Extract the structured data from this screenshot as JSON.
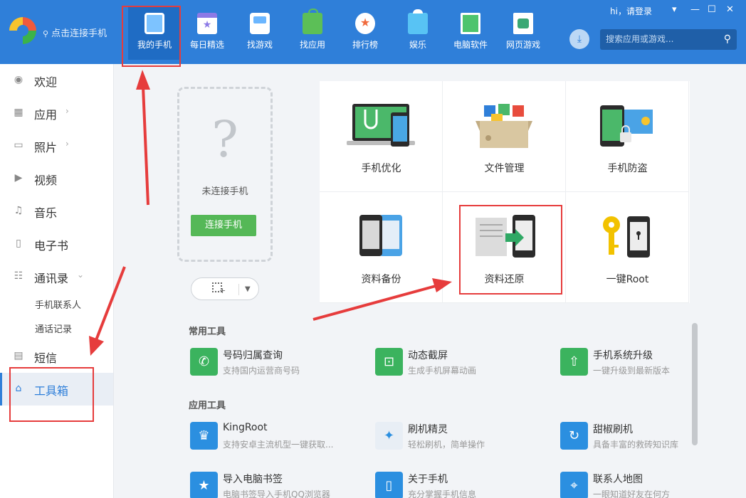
{
  "header": {
    "connect_text": "点击连接手机",
    "login_text": "hi，请登录",
    "search_placeholder": "搜索应用或游戏...",
    "nav": [
      {
        "label": "我的手机",
        "icon": "phone-icon",
        "active": true
      },
      {
        "label": "每日精选",
        "icon": "calendar-star-icon"
      },
      {
        "label": "找游戏",
        "icon": "game-icon"
      },
      {
        "label": "找应用",
        "icon": "app-bag-icon"
      },
      {
        "label": "排行榜",
        "icon": "rank-medal-icon"
      },
      {
        "label": "娱乐",
        "icon": "entertainment-icon"
      },
      {
        "label": "电脑软件",
        "icon": "pc-software-icon"
      },
      {
        "label": "网页游戏",
        "icon": "web-game-icon"
      }
    ]
  },
  "sidebar": {
    "items": [
      {
        "label": "欢迎",
        "icon": "welcome-icon"
      },
      {
        "label": "应用",
        "icon": "apps-grid-icon"
      },
      {
        "label": "照片",
        "icon": "photo-icon"
      },
      {
        "label": "视频",
        "icon": "video-icon"
      },
      {
        "label": "音乐",
        "icon": "music-icon"
      },
      {
        "label": "电子书",
        "icon": "ebook-icon"
      },
      {
        "label": "通讯录",
        "icon": "contacts-icon"
      },
      {
        "label": "短信",
        "icon": "sms-icon"
      },
      {
        "label": "工具箱",
        "icon": "toolbox-icon",
        "active": true
      }
    ],
    "sub_items": [
      "手机联系人",
      "通话记录"
    ]
  },
  "phone_panel": {
    "status": "未连接手机",
    "connect_button": "连接手机"
  },
  "tools": [
    {
      "label": "手机优化"
    },
    {
      "label": "文件管理"
    },
    {
      "label": "手机防盗"
    },
    {
      "label": "资料备份"
    },
    {
      "label": "资料还原"
    },
    {
      "label": "一键Root"
    }
  ],
  "sections": {
    "common_title": "常用工具",
    "app_title": "应用工具"
  },
  "common_tools": [
    {
      "name": "号码归属查询",
      "desc": "支持国内运营商号码",
      "color": "#3bb35e"
    },
    {
      "name": "动态截屏",
      "desc": "生成手机屏幕动画",
      "color": "#3bb35e"
    },
    {
      "name": "手机系统升级",
      "desc": "一键升级到最新版本",
      "color": "#3bb35e"
    }
  ],
  "app_tools": [
    {
      "name": "KingRoot",
      "desc": "支持安卓主流机型一键获取...",
      "color": "#2b8fe0"
    },
    {
      "name": "刷机精灵",
      "desc": "轻松刷机，简单操作",
      "color": "#e8eef5"
    },
    {
      "name": "甜椒刷机",
      "desc": "具备丰富的救砖知识库",
      "color": "#2b8fe0"
    },
    {
      "name": "导入电脑书签",
      "desc": "电脑书签导入手机QQ浏览器",
      "color": "#2b8fe0"
    },
    {
      "name": "关于手机",
      "desc": "充分掌握手机信息",
      "color": "#2b8fe0"
    },
    {
      "name": "联系人地图",
      "desc": "一眼知道好友在何方",
      "color": "#2b8fe0"
    }
  ]
}
